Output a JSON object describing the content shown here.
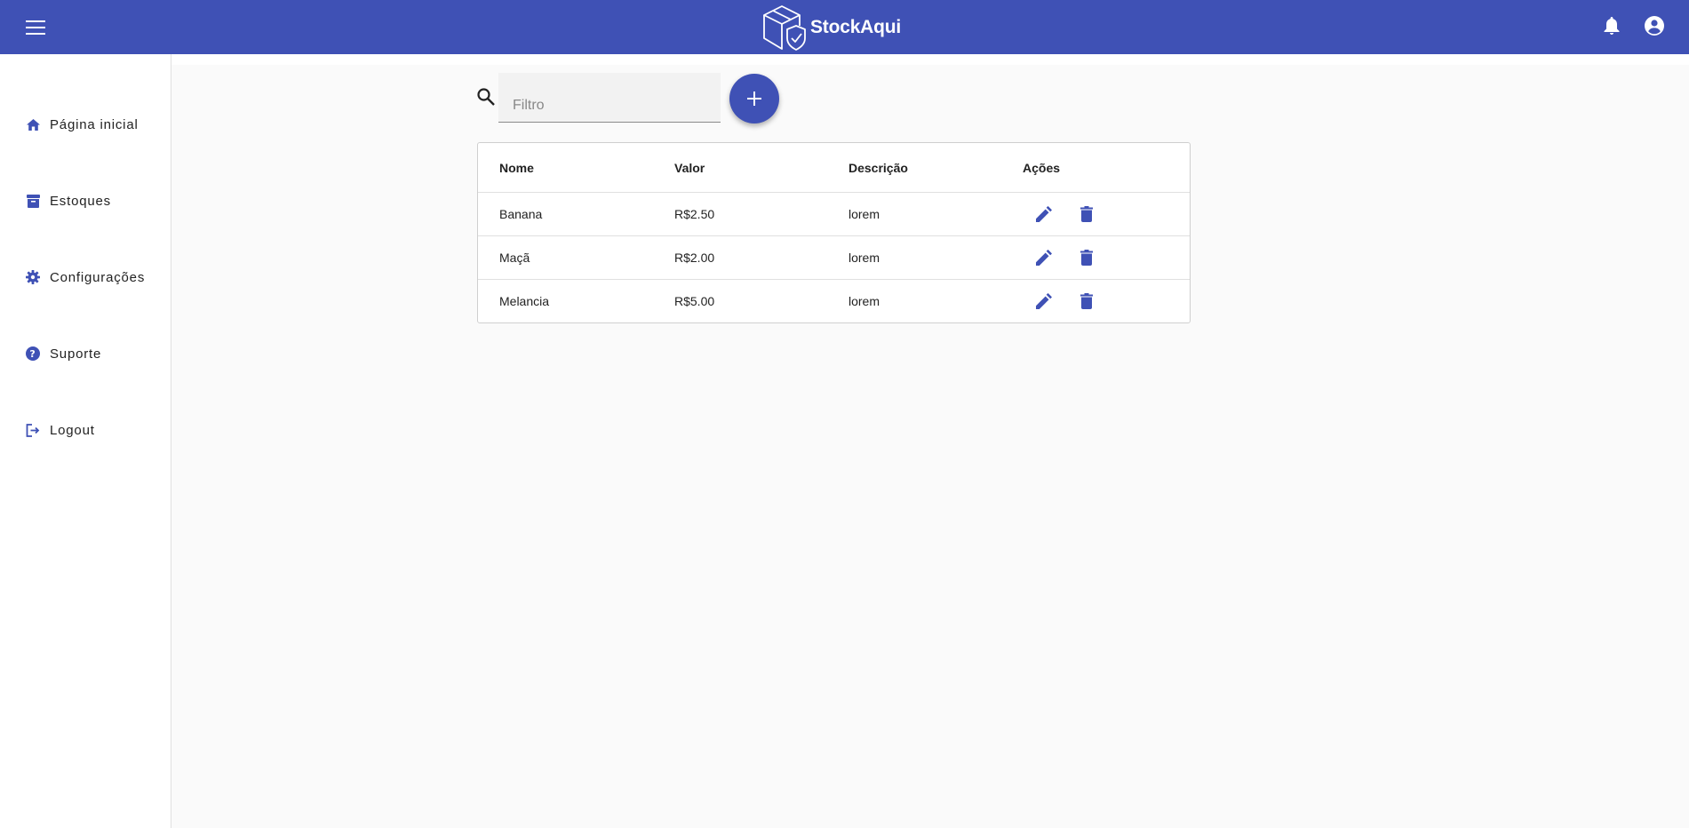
{
  "app": {
    "brand": "StockAqui"
  },
  "colors": {
    "primary": "#3f51b5",
    "background": "#fafafa"
  },
  "header": {
    "menu_icon": "menu-icon",
    "logo_icon": "box-shield-icon",
    "right_icons": [
      "notifications-icon",
      "account-circle-icon"
    ]
  },
  "sidebar": {
    "items": [
      {
        "label": "Página inicial",
        "icon": "home-icon"
      },
      {
        "label": "Estoques",
        "icon": "archive-icon"
      },
      {
        "label": "Configurações",
        "icon": "settings-icon"
      },
      {
        "label": "Suporte",
        "icon": "help-icon"
      },
      {
        "label": "Logout",
        "icon": "logout-icon"
      }
    ]
  },
  "search": {
    "placeholder": "Filtro",
    "value": ""
  },
  "add_button": {
    "icon": "plus-icon"
  },
  "table": {
    "columns": [
      "Nome",
      "Valor",
      "Descrição",
      "Ações"
    ],
    "rows": [
      {
        "nome": "Banana",
        "valor": "R$2.50",
        "descricao": "lorem"
      },
      {
        "nome": "Maçã",
        "valor": "R$2.00",
        "descricao": "lorem"
      },
      {
        "nome": "Melancia",
        "valor": "R$5.00",
        "descricao": "lorem"
      }
    ],
    "action_icons": [
      "edit-icon",
      "delete-icon"
    ]
  }
}
